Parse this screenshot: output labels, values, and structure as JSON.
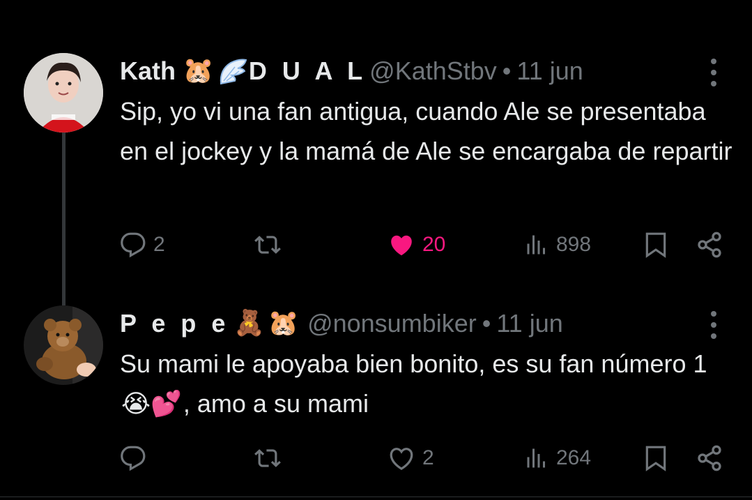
{
  "tweets": [
    {
      "display_name": "Kath",
      "display_name_suffix": "D U A L",
      "name_emojis": [
        "🐹",
        "🪽"
      ],
      "handle": "@KathStbv",
      "separator": "•",
      "time": "11 jun",
      "text": "Sip, yo vi una fan antigua, cuando Ale se presentaba en el jockey y la mamá de Ale se encargaba de repartir",
      "replies": "2",
      "retweets": "",
      "likes": "20",
      "liked": true,
      "views": "898",
      "colors": {
        "like": "#f91880"
      }
    },
    {
      "display_name": "P e p e",
      "name_emojis": [
        "🧸",
        "🐹"
      ],
      "handle": "@nonsumbiker",
      "separator": "•",
      "time": "11 jun",
      "text_before": "Su mami le apoyaba bien bonito, es su fan número 1 ",
      "text_emojis": "😭💕",
      "text_after": ", amo a su mami",
      "replies": "",
      "retweets": "",
      "likes": "2",
      "liked": false,
      "views": "264"
    }
  ],
  "icons": [
    "reply-icon",
    "retweet-icon",
    "heart-icon",
    "views-icon",
    "bookmark-icon",
    "share-icon",
    "more-icon"
  ]
}
